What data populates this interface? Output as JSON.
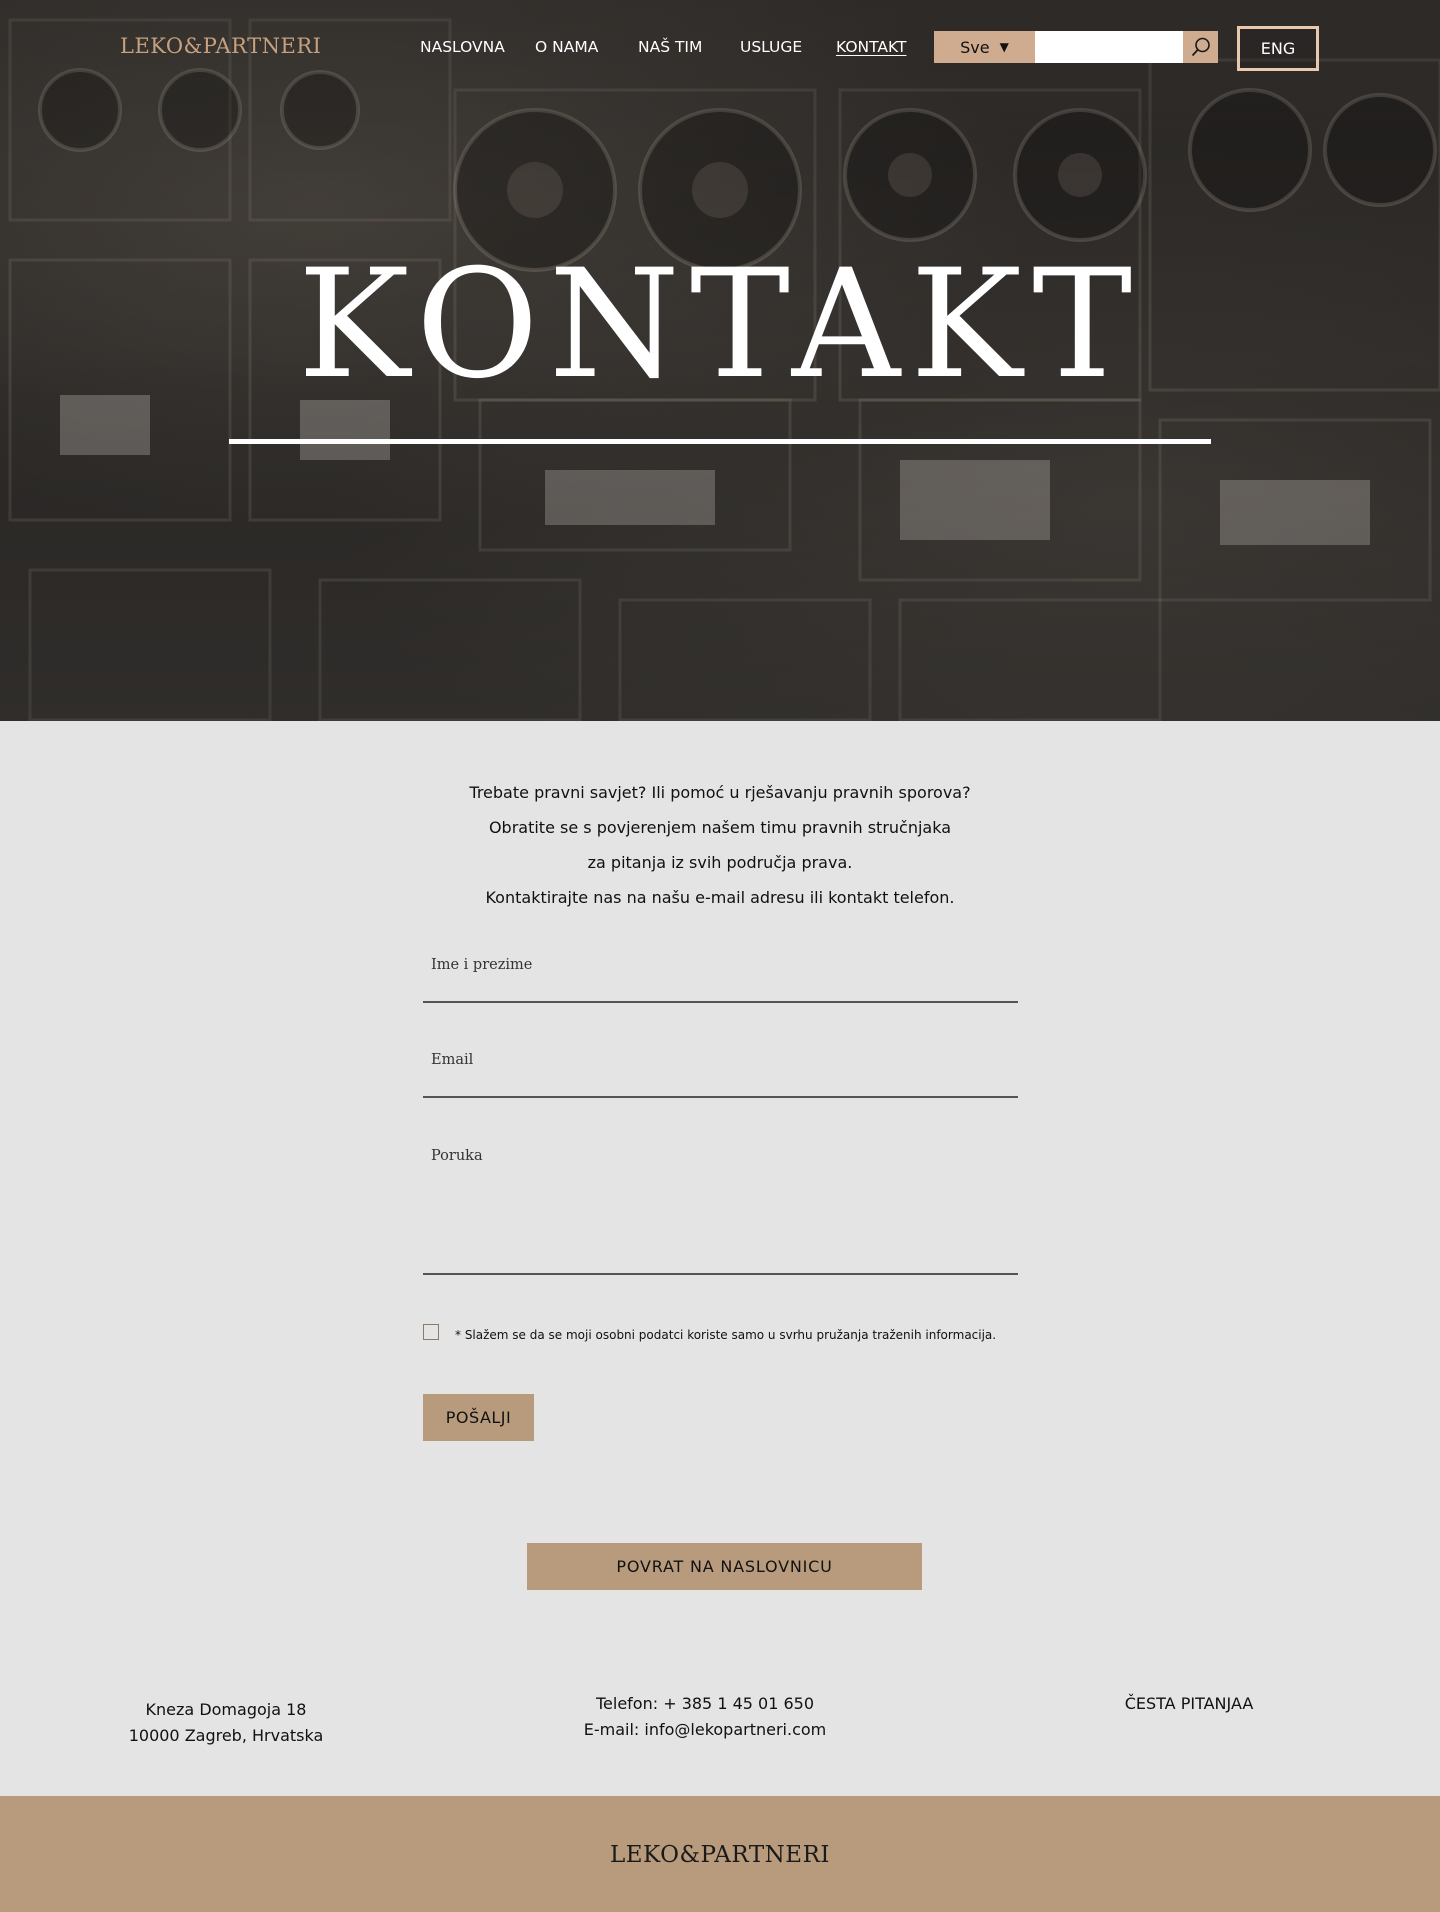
{
  "header": {
    "logo": "LEKO&PARTNERI",
    "nav": [
      {
        "label": "NASLOVNA"
      },
      {
        "label": "O NAMA"
      },
      {
        "label": "NAŠ TIM"
      },
      {
        "label": "USLUGE"
      },
      {
        "label": "KONTAKT",
        "active": true
      }
    ],
    "search": {
      "scope_selected": "Sve",
      "value": "",
      "button_icon": "search-icon"
    },
    "language_button": "ENG"
  },
  "hero": {
    "title": "KONTAKT"
  },
  "intro": {
    "lines": [
      "Trebate pravni savjet? Ili pomoć u rješavanju pravnih sporova?",
      "Obratite se s povjerenjem našem timu pravnih stručnjaka",
      "za pitanja iz svih područja prava.",
      "Kontaktirajte nas na našu e-mail adresu ili kontakt telefon."
    ]
  },
  "form": {
    "name_placeholder": "Ime i prezime",
    "email_placeholder": "Email",
    "message_placeholder": "Poruka",
    "consent_checked": false,
    "consent_text": "* Slažem se da se moji osobni podatci koriste samo u svrhu pružanja traženih informacija.",
    "submit_label": "POŠALJI"
  },
  "back_button": "POVRAT NA NASLOVNICU",
  "footer": {
    "address_line1": "Kneza Domagoja 18",
    "address_line2": "10000 Zagreb, Hrvatska",
    "phone": "Telefon: + 385 1 45 01 650",
    "email": "E-mail: info@lekopartneri.com",
    "faq": "ČESTA PITANJAA",
    "logo": "LEKO&PARTNERI"
  },
  "colors": {
    "accent": "#b89b7d",
    "accent_light": "#cfab90",
    "logo_header": "#c7a17e",
    "page_bg": "#e4e4e4"
  }
}
